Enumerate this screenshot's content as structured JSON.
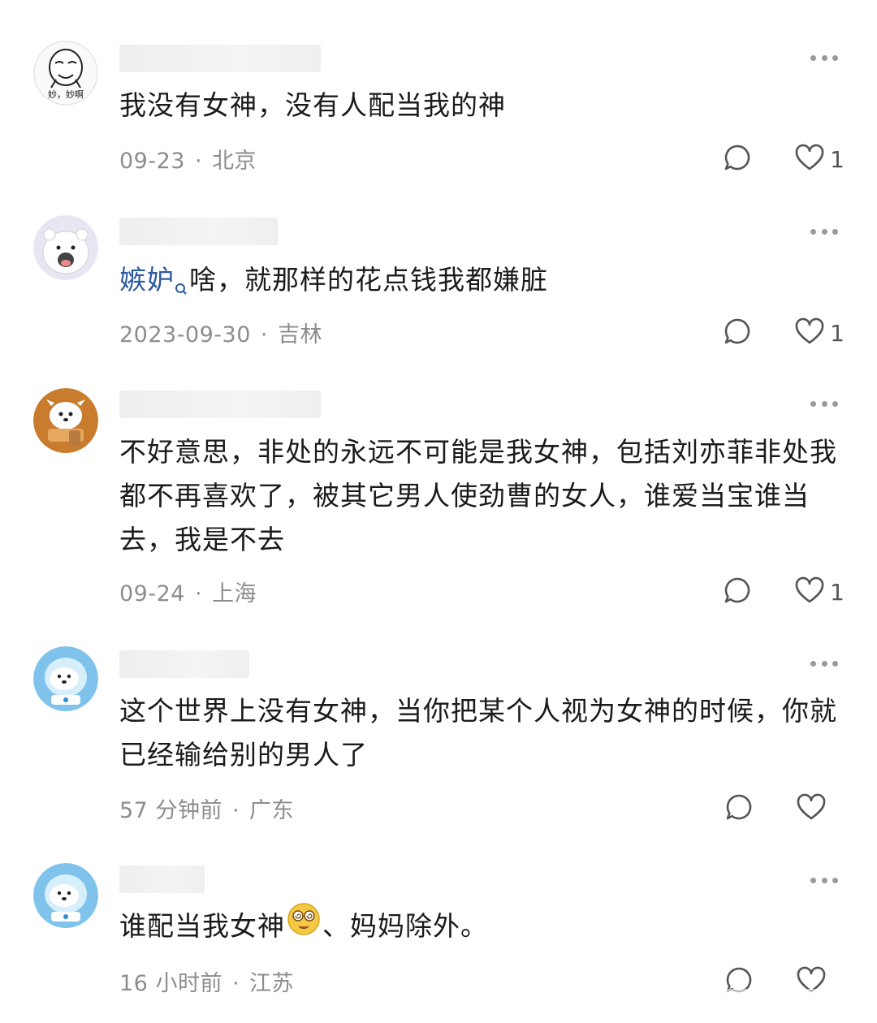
{
  "comments": [
    {
      "avatar": "meme-face-avatar",
      "avatar_caption": "妙，妙啊",
      "text": "我没有女神，没有人配当我的神",
      "date": "09-23",
      "location": "北京",
      "likes": "1"
    },
    {
      "avatar": "white-bear-avatar",
      "mention": "嫉妒",
      "text": "啥，就那样的花点钱我都嫌脏",
      "date": "2023-09-30",
      "location": "吉林",
      "likes": "1"
    },
    {
      "avatar": "dog-scarf-avatar",
      "text": "不好意思，非处的永远不可能是我女神，包括刘亦菲非处我都不再喜欢了，被其它男人使劲曹的女人，谁爱当宝谁当去，我是不去",
      "date": "09-24",
      "location": "上海",
      "likes": "1"
    },
    {
      "avatar": "astronaut-bear-avatar",
      "text": "这个世界上没有女神，当你把某个人视为女神的时候，你就已经输给别的男人了",
      "date": "57 分钟前",
      "location": "广东",
      "likes": ""
    },
    {
      "avatar": "astronaut-bear-avatar",
      "text_before": "谁配当我女神",
      "emoji": "dizzy-face-emoji",
      "text_after": "、妈妈除外。",
      "date": "16 小时前",
      "location": "江苏",
      "likes": ""
    }
  ],
  "meta_separator": "·",
  "colors": {
    "mention": "#2c5aa0",
    "meta": "#8d8d8d",
    "icon": "#555555"
  }
}
